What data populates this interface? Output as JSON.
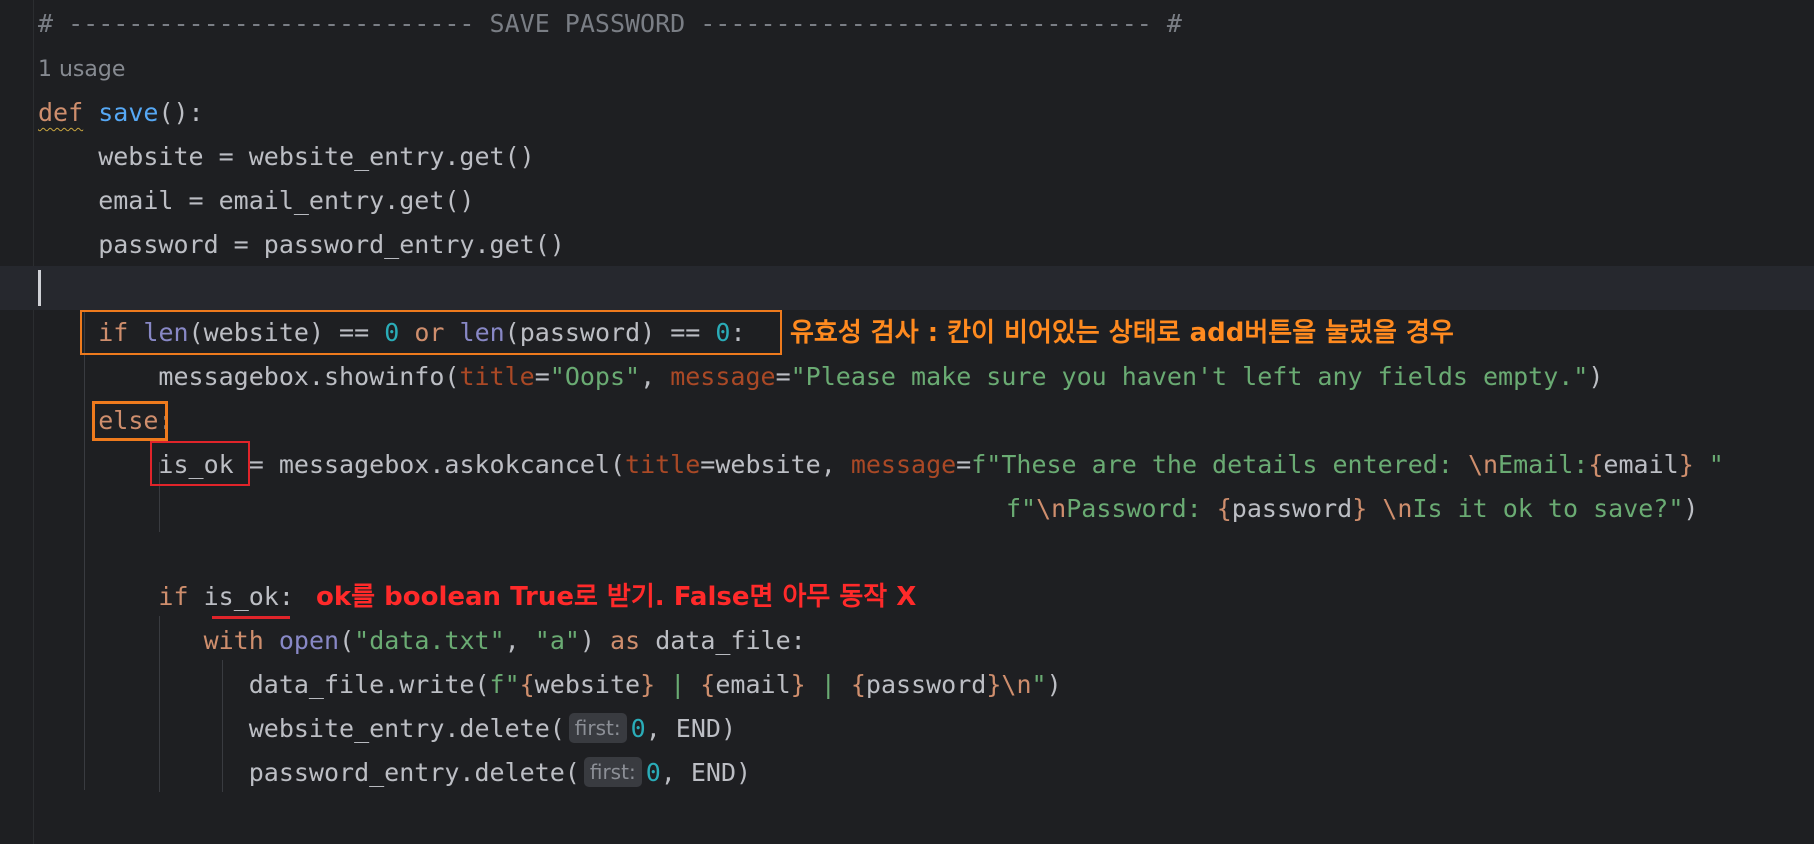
{
  "header_comment": "# --------------------------- SAVE PASSWORD ------------------------------ #",
  "usage_hint": "1 usage",
  "code": {
    "def_kw": "def",
    "fn_name": "save",
    "def_tail": "():",
    "l_website": "    website = website_entry.get()",
    "l_email": "    email = email_entry.get()",
    "l_password": "    password = password_entry.get()",
    "if1_kw": "if",
    "if1_len1": "len",
    "if1_a": "(website) == ",
    "if1_zero1": "0",
    "if1_or": "or",
    "if1_len2": "len",
    "if1_b": "(password) == ",
    "if1_zero2": "0",
    "if1_colon": ":",
    "show_a": "messagebox.showinfo(",
    "show_title_p": "title",
    "show_eq1": "=",
    "show_title_v": "\"Oops\"",
    "show_comma": ", ",
    "show_msg_p": "message",
    "show_eq2": "=",
    "show_msg_v": "\"Please make sure you haven't left any fields empty.\"",
    "show_close": ")",
    "else_kw": "else",
    "else_colon": ":",
    "ask_var": "is_ok",
    "ask_a": " = messagebox.askokcancel(",
    "ask_title_p": "title",
    "ask_title_v": "=website, ",
    "ask_msg_p": "message",
    "ask_eq": "=",
    "ask_f1": "f\"These are the details entered: ",
    "ask_esc1": "\\n",
    "ask_f1b": "Email:",
    "ask_brace_o1": "{",
    "ask_var1": "email",
    "ask_brace_c1": "}",
    "ask_f1c": " \"",
    "ask_f2a": "f\"",
    "ask_esc2": "\\n",
    "ask_f2b": "Password: ",
    "ask_brace_o2": "{",
    "ask_var2": "password",
    "ask_brace_c2": "}",
    "ask_f2c": " ",
    "ask_esc3": "\\n",
    "ask_f2d": "Is it ok to save?\"",
    "ask_close": ")",
    "if2_kw": "if",
    "if2_var": "is_ok",
    "if2_colon": ":",
    "with_kw": "with",
    "with_open": "open",
    "with_a": "(",
    "with_s1": "\"data.txt\"",
    "with_c": ", ",
    "with_s2": "\"a\"",
    "with_b": ") ",
    "with_as": "as",
    "with_tail": " data_file:",
    "write_a": "data_file.write(",
    "write_f": "f\"",
    "write_bo1": "{",
    "write_v1": "website",
    "write_bc1": "}",
    "write_sep1": " | ",
    "write_bo2": "{",
    "write_v2": "email",
    "write_bc2": "}",
    "write_sep2": " | ",
    "write_bo3": "{",
    "write_v3": "password",
    "write_bc3": "}",
    "write_esc": "\\n",
    "write_q": "\"",
    "write_close": ")",
    "del1_a": "website_entry.delete(",
    "del1_hint": "first:",
    "del1_num": "0",
    "del1_tail": ", END)",
    "del2_a": "password_entry.delete(",
    "del2_hint": "first:",
    "del2_num": "0",
    "del2_tail": ", END)"
  },
  "annotations": {
    "validation": "유효성 검사 : 칸이 비어있는 상태로 add버튼을 눌렀을 경우",
    "ok_bool": "ok를 boolean True로 받기. False면 아무 동작 X"
  },
  "colors": {
    "background": "#1e1f22",
    "annotation_orange": "#ff8a1f",
    "annotation_red": "#ff2a2a"
  }
}
